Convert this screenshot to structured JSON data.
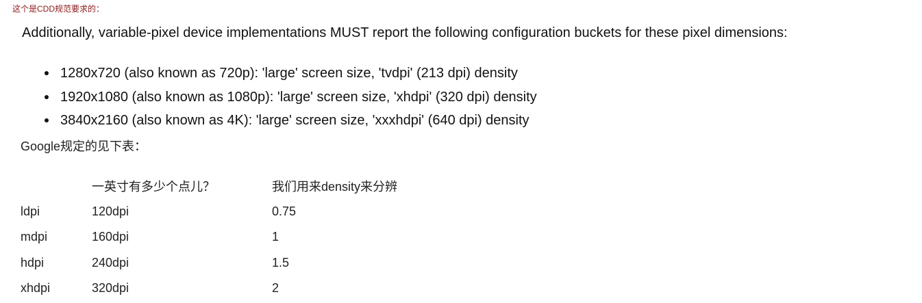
{
  "note": "这个是CDD规范要求的：",
  "cdd": {
    "paragraph": "Additionally, variable-pixel device implementations MUST report the following configuration buckets for these pixel dimensions:",
    "items": [
      "1280x720 (also known as 720p): 'large' screen size, 'tvdpi' (213 dpi) density",
      "1920x1080 (also known as 1080p): 'large' screen size, 'xhdpi' (320 dpi) density",
      "3840x2160 (also known as 4K): 'large' screen size, 'xxxhdpi' (640 dpi) density"
    ]
  },
  "google_line": "Google规定的见下表：",
  "table": {
    "headers": [
      "",
      "一英寸有多少个点儿？",
      "我们用来density来分辨"
    ],
    "rows": [
      [
        "ldpi",
        "120dpi",
        "0.75"
      ],
      [
        "mdpi",
        "160dpi",
        "1"
      ],
      [
        "hdpi",
        "240dpi",
        "1.5"
      ],
      [
        "xhdpi",
        "320dpi",
        "2"
      ]
    ]
  }
}
